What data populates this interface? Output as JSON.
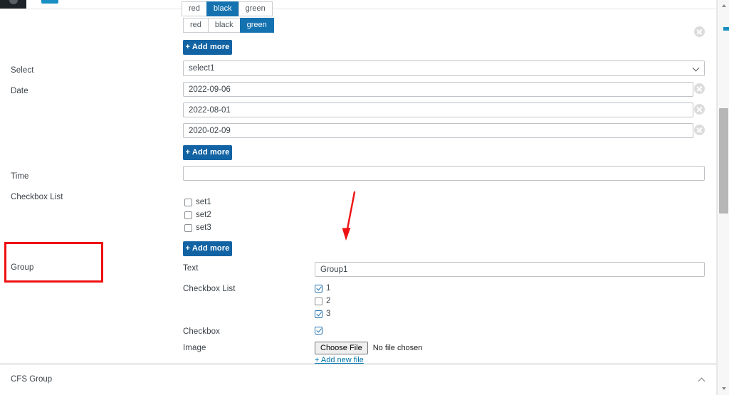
{
  "browser": {
    "tab_accent_color": "#1a8fc4",
    "adminbar_color": "#1d2327"
  },
  "accent": {
    "primary_blue": "#1263a4",
    "segment_active_blue": "#1572b0",
    "link_blue": "#0073aa",
    "annotation_red": "#ee1111"
  },
  "panel": {
    "button_group_clipped": {
      "name": "color-buttons-row-1",
      "options": [
        "red",
        "black",
        "green"
      ],
      "selected": "black"
    },
    "button_group": {
      "name": "color-buttons-row-2",
      "options": [
        "red",
        "black",
        "green"
      ],
      "selected": "green"
    },
    "add_more_label": "+ Add more",
    "fields": [
      {
        "label": "Select",
        "type": "select",
        "value": "select1",
        "options": [
          "select1"
        ]
      },
      {
        "label": "Date",
        "type": "date-repeater",
        "values": [
          "2022-09-06",
          "2022-08-01",
          "2020-02-09"
        ]
      },
      {
        "label": "Time",
        "type": "text",
        "value": "",
        "placeholder": ""
      },
      {
        "label": "Checkbox List",
        "type": "checkbox-list",
        "items": [
          {
            "label": "set1",
            "checked": false
          },
          {
            "label": "set2",
            "checked": false
          },
          {
            "label": "set3",
            "checked": false
          }
        ]
      },
      {
        "label": "Group",
        "type": "group"
      }
    ],
    "group": {
      "label": "Group",
      "sub_fields": [
        {
          "label": "Text",
          "type": "text",
          "value": "Group1"
        },
        {
          "label": "Checkbox List",
          "type": "checkbox-list",
          "items": [
            {
              "label": "1",
              "checked": true
            },
            {
              "label": "2",
              "checked": false
            },
            {
              "label": "3",
              "checked": true
            }
          ]
        },
        {
          "label": "Checkbox",
          "type": "checkbox",
          "checked": true
        },
        {
          "label": "Image",
          "type": "file",
          "button_label": "Choose File",
          "file_status": "No file chosen",
          "add_link": "+ Add new file"
        }
      ]
    }
  },
  "cfs_box": {
    "title": "CFS Group",
    "toggle_icon": "chevron-up-icon"
  },
  "icons": {
    "remove": "remove-circle-x-icon",
    "chevron_down": "chevron-down-icon",
    "scroll_up": "scroll-up-arrow-icon",
    "scroll_down": "scroll-down-arrow-icon"
  }
}
